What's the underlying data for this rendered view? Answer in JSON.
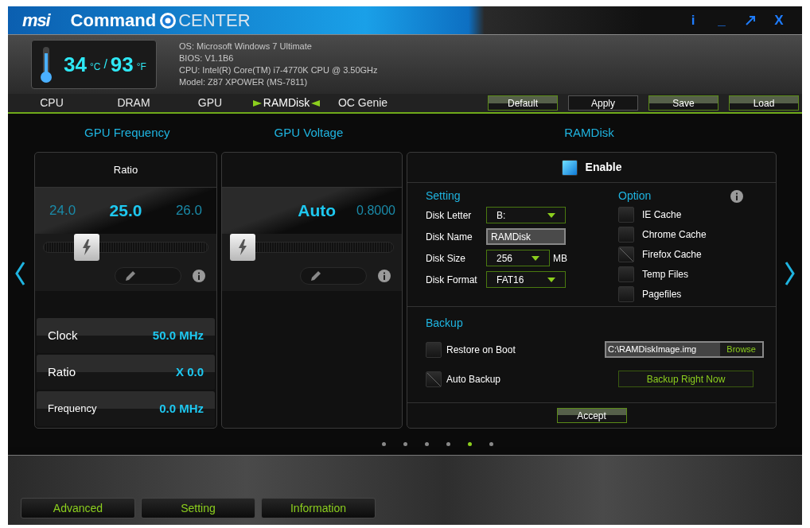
{
  "title": {
    "brand": "msi",
    "app": "Command",
    "app_suffix": "CENTER",
    "buttons": [
      "i",
      "_",
      "X"
    ]
  },
  "temperature": {
    "celsius": "34",
    "celsius_unit": "°C",
    "separator": "/",
    "fahrenheit": "93",
    "fahrenheit_unit": "°F"
  },
  "system_info": [
    "OS: Microsoft Windows 7 Ultimate",
    "BIOS: V1.1B6",
    "CPU: Intel(R) Core(TM) i7-4770K CPU @ 3.50GHz",
    "Model: Z87 XPOWER (MS-7811)"
  ],
  "tabs": [
    {
      "label": "CPU",
      "selected": false
    },
    {
      "label": "DRAM",
      "selected": false
    },
    {
      "label": "GPU",
      "selected": false
    },
    {
      "label": "RAMDisk",
      "selected": true
    },
    {
      "label": "OC Genie",
      "selected": false
    }
  ],
  "actions": [
    {
      "label": "Default",
      "highlighted": true
    },
    {
      "label": "Apply",
      "highlighted": false
    },
    {
      "label": "Save",
      "highlighted": true
    },
    {
      "label": "Load",
      "highlighted": true
    }
  ],
  "gpu_frequency": {
    "heading": "GPU Frequency",
    "title": "Ratio",
    "prev": "24.0",
    "current": "25.0",
    "next": "26.0",
    "level": 0.22,
    "readings": [
      {
        "label": "Clock",
        "value": "50.0 MHz"
      },
      {
        "label": "Ratio",
        "value": "X 0.0"
      },
      {
        "label": "Frequency",
        "value": "0.0 MHz"
      }
    ]
  },
  "gpu_voltage": {
    "heading": "GPU Voltage",
    "current": "Auto",
    "next": "0.8000",
    "level": 0
  },
  "ramdisk": {
    "heading": "RAMDisk",
    "enable": {
      "label": "Enable",
      "checked": true
    },
    "setting_title": "Setting",
    "fields": [
      {
        "kind": "select",
        "label": "Disk Letter",
        "value": "B:"
      },
      {
        "kind": "text",
        "label": "Disk Name",
        "value": "RAMDisk"
      },
      {
        "kind": "select",
        "label": "Disk Size",
        "value": "256",
        "unit": "MB"
      },
      {
        "kind": "select",
        "label": "Disk Format",
        "value": "FAT16"
      }
    ],
    "option_title": "Option",
    "options": [
      {
        "label": "IE Cache",
        "disabled": false
      },
      {
        "label": "Chrome Cache",
        "disabled": false
      },
      {
        "label": "Firefox Cache",
        "disabled": true
      },
      {
        "label": "Temp Files",
        "disabled": false
      },
      {
        "label": "Pagefiles",
        "disabled": false
      }
    ],
    "backup_title": "Backup",
    "restore": {
      "label": "Restore on Boot",
      "disabled": false
    },
    "auto_backup": {
      "label": "Auto Backup",
      "disabled": true
    },
    "image_path": "C:\\RAMDiskImage.img",
    "browse": "Browse",
    "backup_now": "Backup Right Now",
    "accept": "Accept"
  },
  "pages": [
    {
      "selected": false
    },
    {
      "selected": false
    },
    {
      "selected": false
    },
    {
      "selected": false
    },
    {
      "selected": true
    },
    {
      "selected": false
    }
  ],
  "bottom_buttons": [
    "Advanced",
    "Setting",
    "Information"
  ]
}
